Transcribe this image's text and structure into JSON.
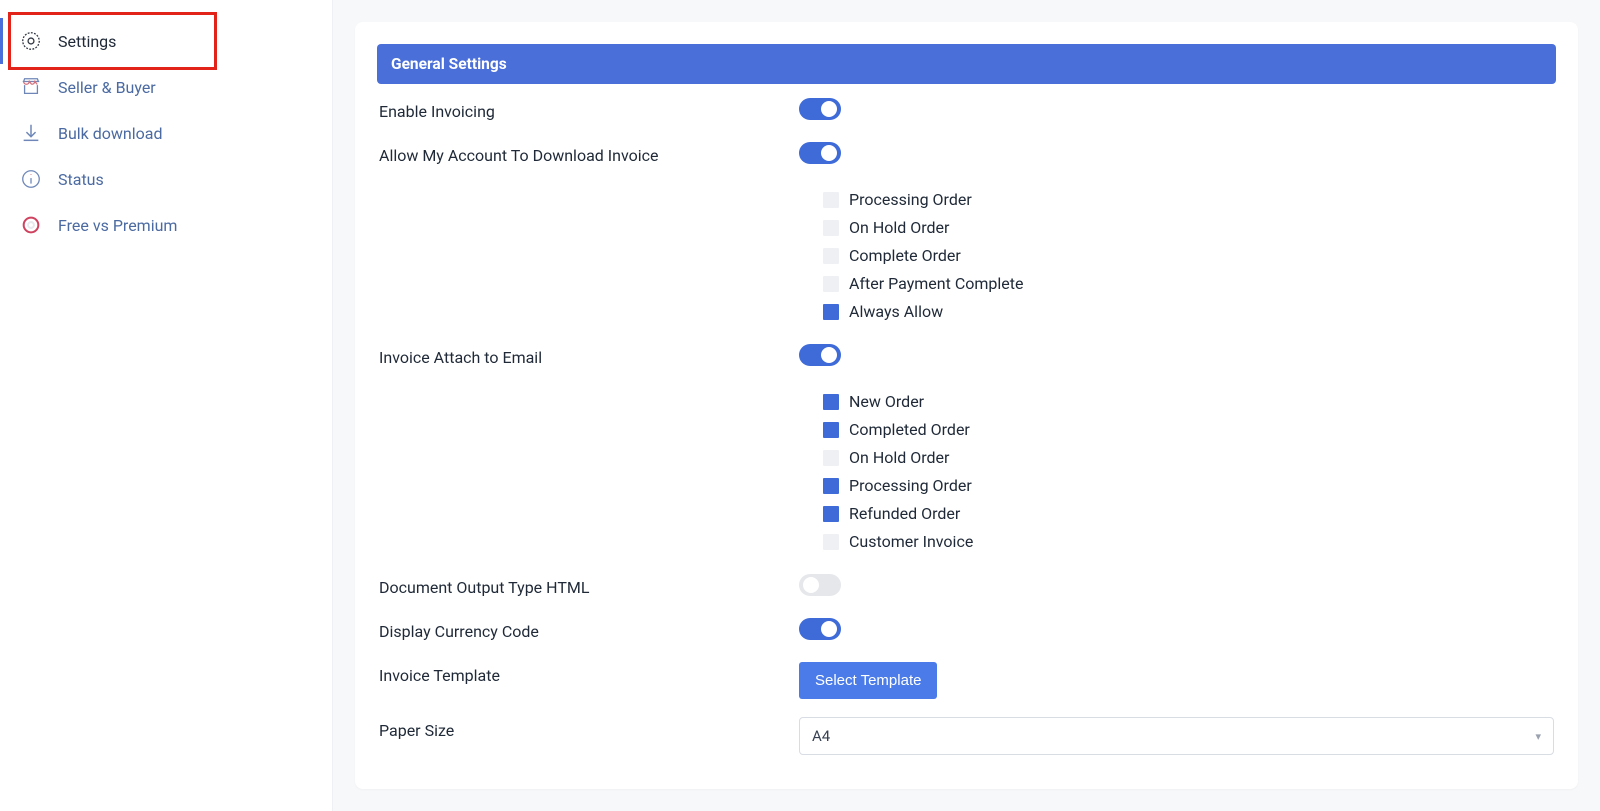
{
  "sidebar": {
    "items": [
      {
        "label": "Settings",
        "icon": "gear-icon",
        "active": true
      },
      {
        "label": "Seller & Buyer",
        "icon": "store-icon",
        "active": false
      },
      {
        "label": "Bulk download",
        "icon": "download-icon",
        "active": false
      },
      {
        "label": "Status",
        "icon": "info-icon",
        "active": false
      },
      {
        "label": "Free vs Premium",
        "icon": "ring-icon",
        "active": false
      }
    ]
  },
  "section": {
    "title": "General Settings"
  },
  "settings": {
    "enable_invoicing": {
      "label": "Enable Invoicing",
      "on": true
    },
    "allow_download": {
      "label": "Allow My Account To Download Invoice",
      "on": true,
      "options": [
        {
          "label": "Processing Order",
          "checked": false
        },
        {
          "label": "On Hold Order",
          "checked": false
        },
        {
          "label": "Complete Order",
          "checked": false
        },
        {
          "label": "After Payment Complete",
          "checked": false
        },
        {
          "label": "Always Allow",
          "checked": true
        }
      ]
    },
    "attach_email": {
      "label": "Invoice Attach to Email",
      "on": true,
      "options": [
        {
          "label": "New Order",
          "checked": true
        },
        {
          "label": "Completed Order",
          "checked": true
        },
        {
          "label": "On Hold Order",
          "checked": false
        },
        {
          "label": "Processing Order",
          "checked": true
        },
        {
          "label": "Refunded Order",
          "checked": true
        },
        {
          "label": "Customer Invoice",
          "checked": false
        }
      ]
    },
    "output_html": {
      "label": "Document Output Type HTML",
      "on": false
    },
    "currency_code": {
      "label": "Display Currency Code",
      "on": true
    },
    "invoice_template": {
      "label": "Invoice Template",
      "button": "Select Template"
    },
    "paper_size": {
      "label": "Paper Size",
      "value": "A4"
    }
  }
}
